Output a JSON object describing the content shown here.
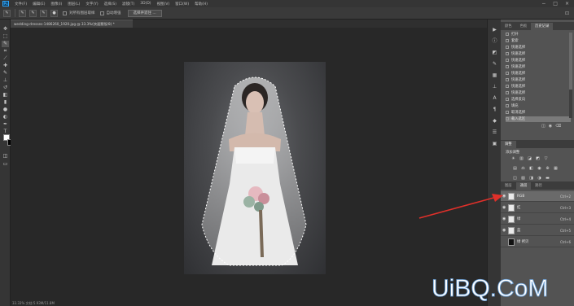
{
  "app": {
    "logo_text": "Ps"
  },
  "menubar": {
    "items": [
      "文件(F)",
      "编辑(E)",
      "图像(I)",
      "图层(L)",
      "文字(Y)",
      "选择(S)",
      "滤镜(T)",
      "3D(D)",
      "视图(V)",
      "窗口(W)",
      "帮助(H)"
    ],
    "window_controls": [
      "−",
      "□",
      "×"
    ]
  },
  "options": {
    "checkbox1_label": "对所有图层取样",
    "checkbox2_label": "自动增强",
    "button_label": "选择并遮住 ...",
    "right_icon": "⊡"
  },
  "document": {
    "tab_title": "wedding-dresses-1486260_1920.jpg @ 33.3%(快速蒙版/8) *",
    "status_text": "33.33%    文档:5.93M/11.8M"
  },
  "history_panel": {
    "tabs": [
      "颜色",
      "色板",
      "历史记录"
    ],
    "active_tab": 2,
    "rows": [
      "打开",
      "套索",
      "快速选择",
      "快速选择",
      "快速选择",
      "快速选择",
      "快速选择",
      "快速选择",
      "快速选择",
      "快速选择",
      "选择反向",
      "填充",
      "取消选择",
      "载入选区"
    ],
    "selected_row": 13
  },
  "adjust_panel": {
    "tabs": [
      "调整"
    ],
    "subtitle": "添加调整"
  },
  "layers_panel": {
    "tabs": [
      "图层",
      "通道",
      "路径"
    ],
    "active_tab": 1,
    "rows": [
      {
        "name": "RGB",
        "shortcut": "Ctrl+2"
      },
      {
        "name": "红",
        "shortcut": "Ctrl+3"
      },
      {
        "name": "绿",
        "shortcut": "Ctrl+4"
      },
      {
        "name": "蓝",
        "shortcut": "Ctrl+5"
      },
      {
        "name": "绿 拷贝",
        "shortcut": "Ctrl+6"
      }
    ],
    "selected_row": 0
  },
  "colors": {
    "arrow": "#e0302a",
    "watermark": "#ffffff",
    "accent": "#31a8ff"
  },
  "watermark": {
    "text": "UiBQ.CoM"
  }
}
